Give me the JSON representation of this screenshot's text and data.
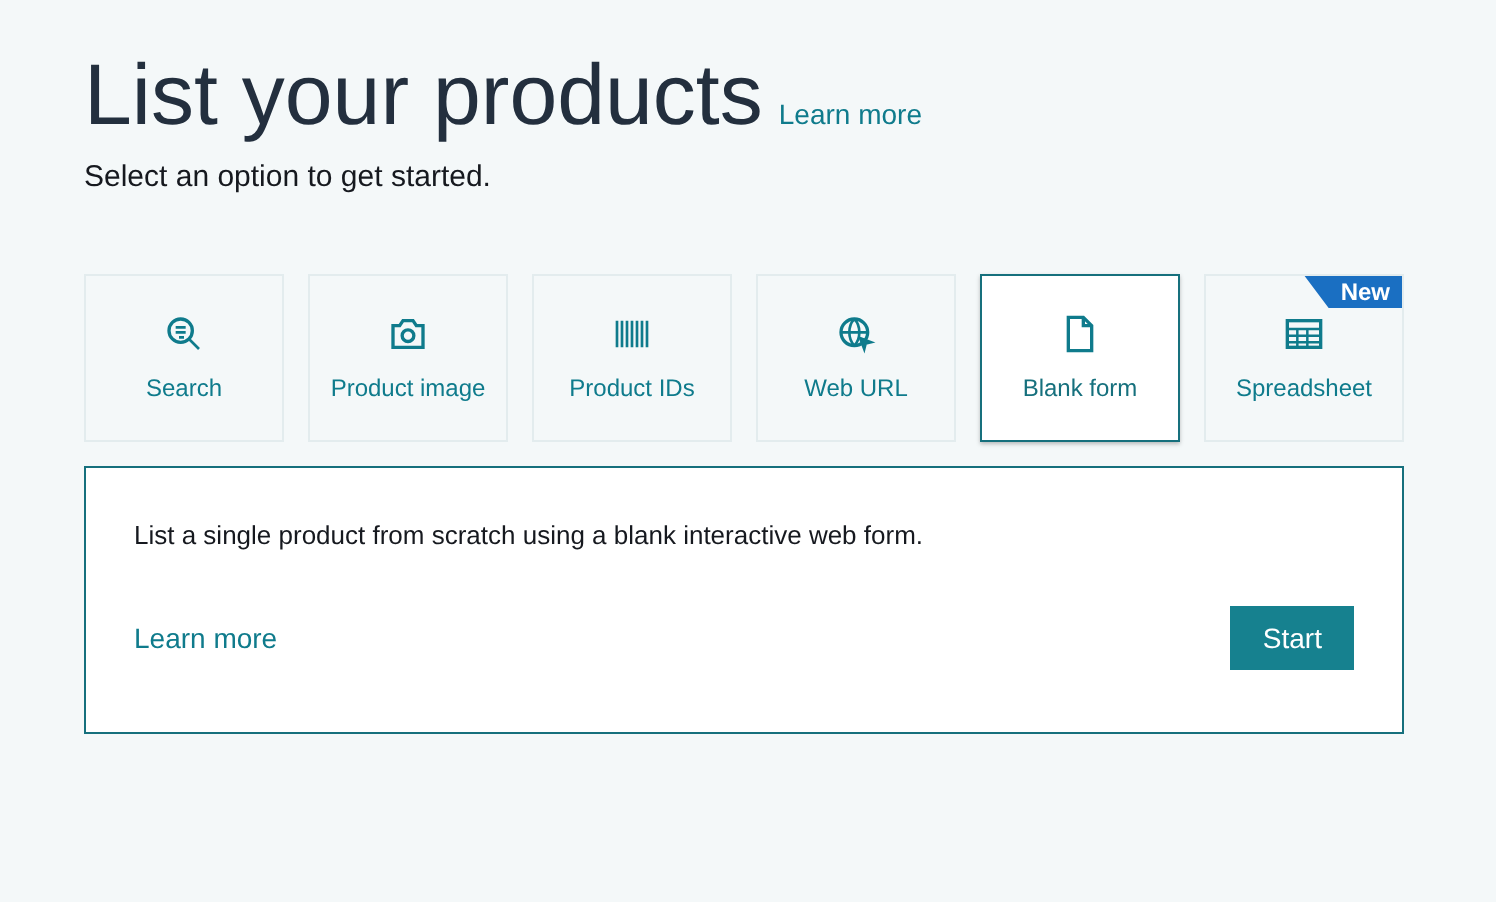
{
  "header": {
    "title": "List your products",
    "learn_more": "Learn more",
    "subtitle": "Select an option to get started."
  },
  "options": [
    {
      "kind": "search",
      "label": "Search",
      "selected": false
    },
    {
      "kind": "camera",
      "label": "Product image",
      "selected": false
    },
    {
      "kind": "barcode",
      "label": "Product IDs",
      "selected": false
    },
    {
      "kind": "globe",
      "label": "Web URL",
      "selected": false
    },
    {
      "kind": "document",
      "label": "Blank form",
      "selected": true
    },
    {
      "kind": "grid",
      "label": "Spreadsheet",
      "selected": false,
      "badge": "New"
    }
  ],
  "panel": {
    "description": "List a single product from scratch using a blank interactive web form.",
    "learn_more": "Learn more",
    "button": "Start"
  }
}
